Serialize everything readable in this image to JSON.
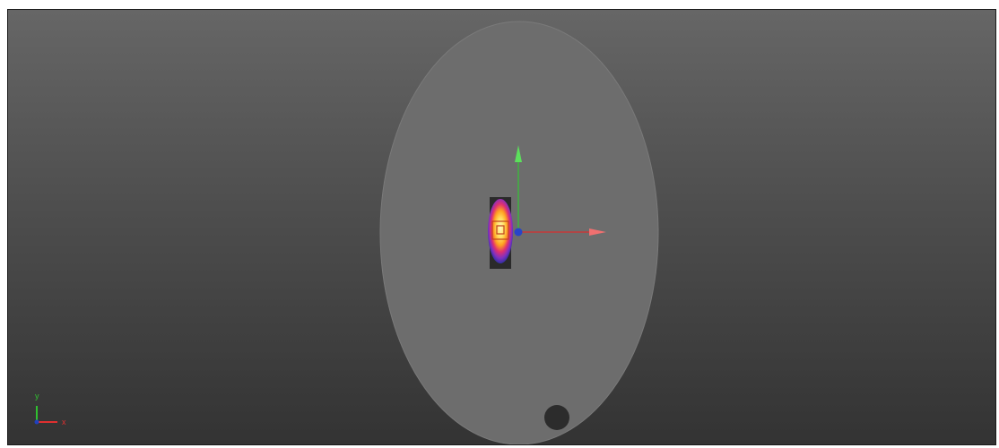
{
  "viewport": {
    "background_top": "#666666",
    "background_bottom": "#333333"
  },
  "scene": {
    "disk_color": "#6a6a6a",
    "hole_color": "#2a2a2a"
  },
  "gizmo": {
    "x_axis_color": "#e03030",
    "y_axis_color": "#30c030",
    "origin_color": "#2040c0"
  },
  "orientation_triad": {
    "x_label": "x",
    "y_label": "y",
    "x_color": "#e03030",
    "y_color": "#30c030"
  }
}
